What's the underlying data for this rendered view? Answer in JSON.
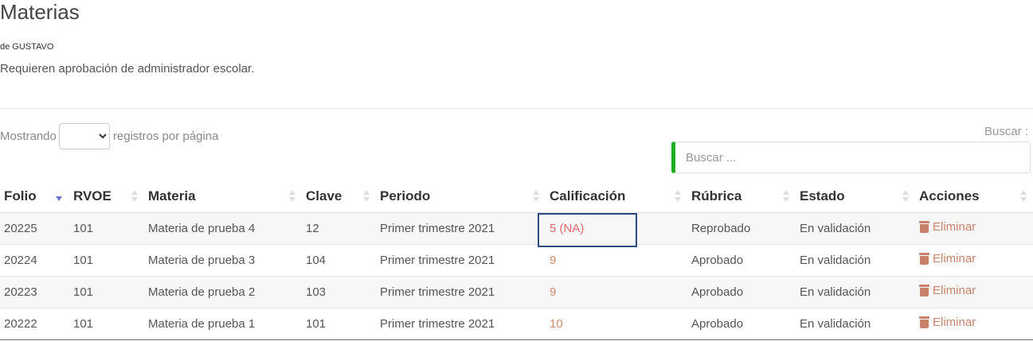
{
  "page": {
    "title": "Materias",
    "subtitle": "de GUSTAVO",
    "note": "Requieren aprobación de administrador escolar."
  },
  "length_control": {
    "prefix": "Mostrando",
    "suffix": "registros por página",
    "selected": ""
  },
  "search": {
    "label": "Buscar :",
    "placeholder": "Buscar ..."
  },
  "table": {
    "columns": [
      "Folio",
      "RVOE",
      "Materia",
      "Clave",
      "Periodo",
      "Calificación",
      "Rúbrica",
      "Estado",
      "Acciones"
    ],
    "sorted_column": "Folio",
    "sort_direction": "descending",
    "rows": [
      {
        "folio": "20225",
        "rvoe": "101",
        "materia": "Materia de prueba 4",
        "clave": "12",
        "periodo": "Primer trimestre 2021",
        "calificacion": "5 (NA)",
        "rubrica": "Reprobado",
        "estado": "En validación",
        "accion": "Eliminar"
      },
      {
        "folio": "20224",
        "rvoe": "101",
        "materia": "Materia de prueba 3",
        "clave": "104",
        "periodo": "Primer trimestre 2021",
        "calificacion": "9",
        "rubrica": "Aprobado",
        "estado": "En validación",
        "accion": "Eliminar"
      },
      {
        "folio": "20223",
        "rvoe": "101",
        "materia": "Materia de prueba 2",
        "clave": "103",
        "periodo": "Primer trimestre 2021",
        "calificacion": "9",
        "rubrica": "Aprobado",
        "estado": "En validación",
        "accion": "Eliminar"
      },
      {
        "folio": "20222",
        "rvoe": "101",
        "materia": "Materia de prueba 1",
        "clave": "101",
        "periodo": "Primer trimestre 2021",
        "calificacion": "10",
        "rubrica": "Aprobado",
        "estado": "En validación",
        "accion": "Eliminar"
      }
    ]
  },
  "colors": {
    "search_accent": "#1fae1f",
    "link": "#c9826a",
    "failing_grade": "#e0676c",
    "highlight_box": "#2b4a7b",
    "sort_active": "#6b74d6"
  },
  "icons": {
    "delete": "trash-icon",
    "sort": "sort-arrows-icon",
    "dropdown": "chevron-down-icon"
  }
}
